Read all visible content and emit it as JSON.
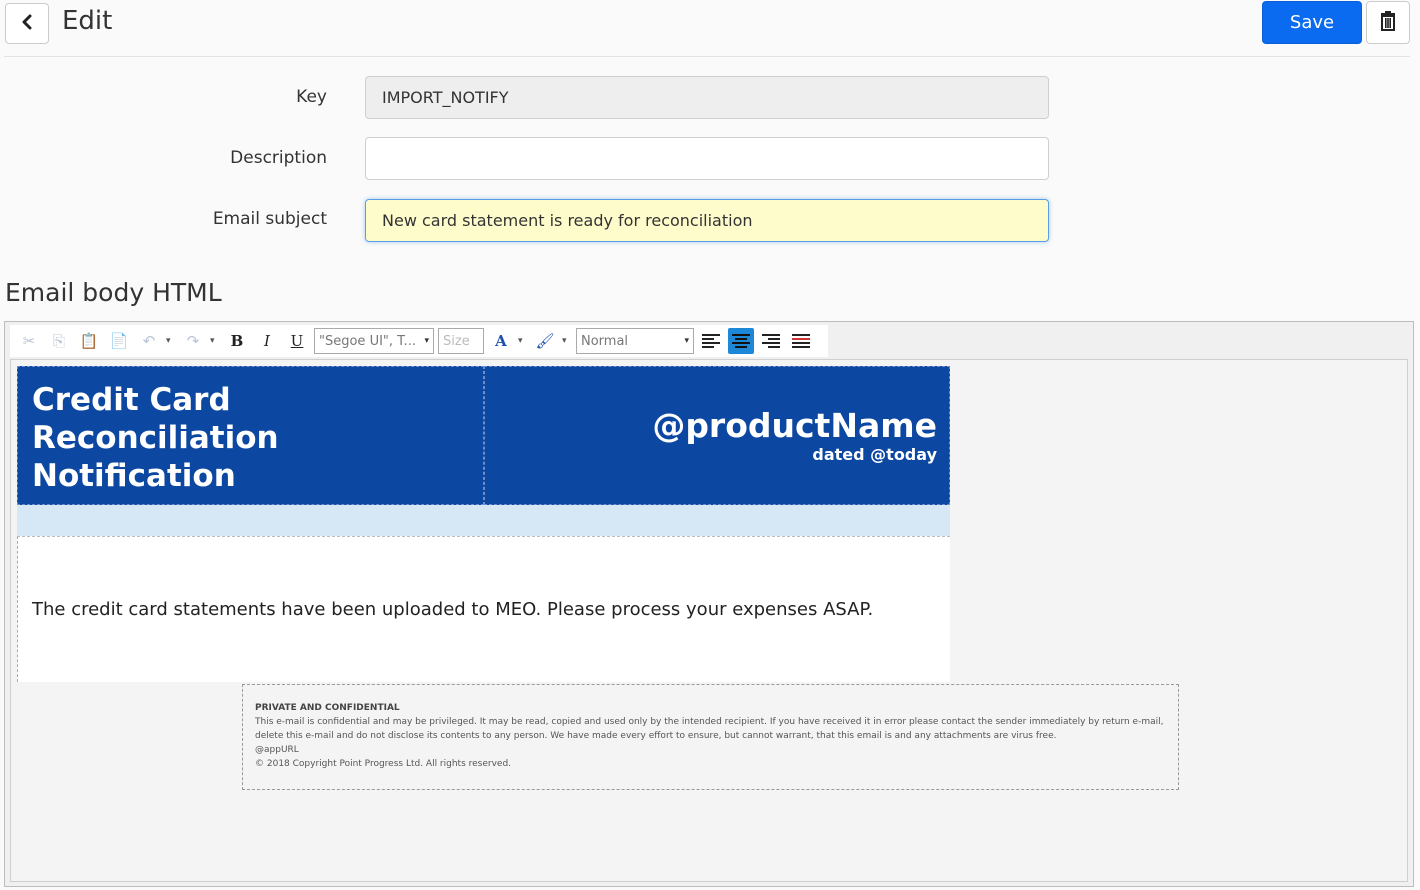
{
  "header": {
    "title": "Edit",
    "save_label": "Save"
  },
  "form": {
    "key_label": "Key",
    "key_value": "IMPORT_NOTIFY",
    "description_label": "Description",
    "description_value": "",
    "subject_label": "Email subject",
    "subject_value": "New card statement is ready for reconciliation"
  },
  "section": {
    "title": "Email body HTML"
  },
  "toolbar": {
    "font_family": "\"Segoe UI\", T...",
    "font_size_placeholder": "Size",
    "format": "Normal"
  },
  "email": {
    "heading_line1": "Credit Card",
    "heading_line2": "Reconciliation",
    "heading_line3": "Notification",
    "product_name": "@productName",
    "dated": "dated @today",
    "body_text": "The credit card statements have been uploaded to MEO. Please process your expenses ASAP.",
    "footer_title": "PRIVATE AND CONFIDENTIAL",
    "footer_line1": "This e-mail is confidential and may be privileged. It may be read, copied and used only by the intended recipient. If you have received it in error please contact the sender immediately by return e-mail,",
    "footer_line2": "delete this e-mail and do not disclose its contents to any person. We have made every effort to ensure, but cannot warrant, that this email is and any attachments are virus free.",
    "footer_line3": "@appURL",
    "footer_line4": "© 2018 Copyright Point Progress Ltd. All rights reserved."
  },
  "colors": {
    "primary": "#0a6af0",
    "email_header_bg": "#0c47a1",
    "email_band_bg": "#d6e8f5",
    "focused_input_bg": "#fffccc"
  }
}
